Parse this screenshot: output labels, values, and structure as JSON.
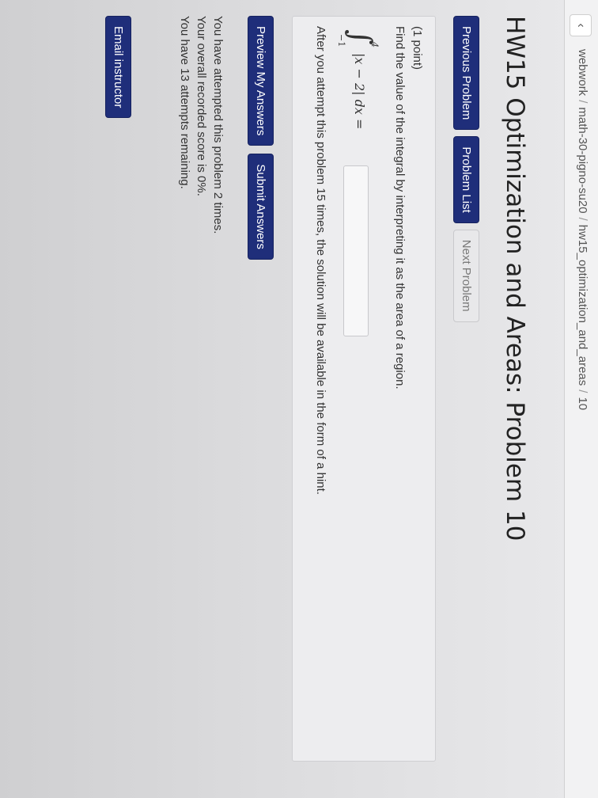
{
  "breadcrumb": {
    "back_icon": "chevron-left-icon",
    "items": [
      "webwork",
      "math-30-pigno-su20",
      "hw15_optimization_and_areas",
      "10"
    ],
    "separator": "/"
  },
  "title": "HW15 Optimization and Areas: Problem 10",
  "nav": {
    "previous": "Previous Problem",
    "list": "Problem List",
    "next": "Next Problem"
  },
  "problem": {
    "points": "(1 point)",
    "prompt": "Find the value of the integral by interpreting it as the area of a region.",
    "integral": {
      "symbol": "∫",
      "upper": "4",
      "lower": "−1",
      "integrand": "|x − 2| dx ="
    },
    "answer_value": "",
    "note": "After you attempt this problem 15 times, the solution will be available in the form of a hint."
  },
  "actions": {
    "preview": "Preview My Answers",
    "submit": "Submit Answers"
  },
  "status": {
    "attempts": "You have attempted this problem 2 times.",
    "score": "Your overall recorded score is 0%.",
    "remaining": "You have 13 attempts remaining."
  },
  "email": "Email instructor",
  "colors": {
    "primary_button": "#1f2e7a",
    "disabled_button": "#e8e8ea"
  }
}
